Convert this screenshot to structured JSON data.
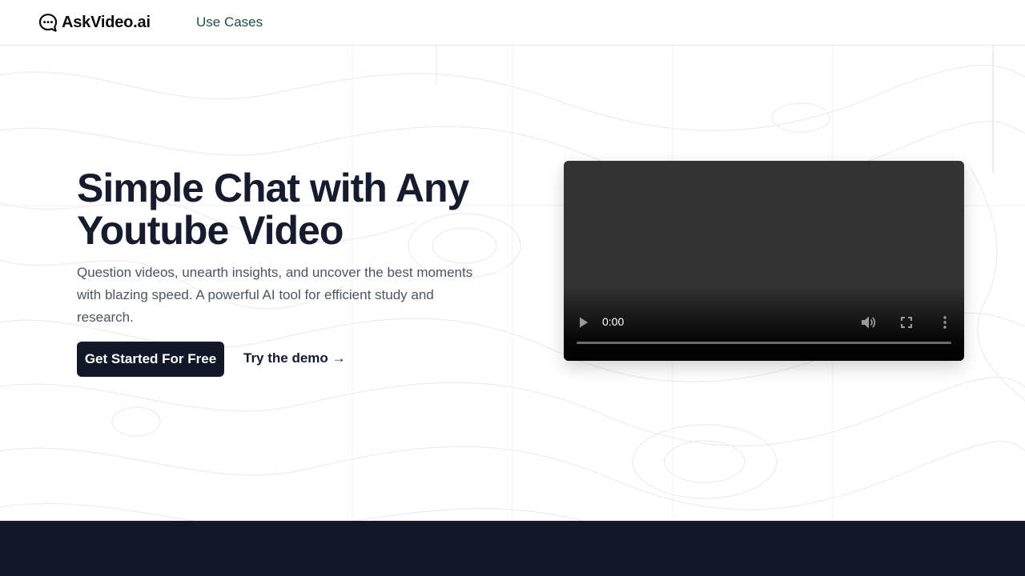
{
  "header": {
    "brand": "AskVideo.ai",
    "nav": [
      {
        "label": "Use Cases"
      }
    ]
  },
  "hero": {
    "headline": "Simple Chat with Any Youtube Video",
    "subheadline": "Question videos, unearth insights, and uncover the best moments with blazing speed. A powerful AI tool for efficient study and research.",
    "primary_cta": "Get Started For Free",
    "secondary_cta": "Try the demo →"
  },
  "video_player": {
    "time": "0:00",
    "progress": 0,
    "icons": [
      "play-icon",
      "volume-icon",
      "fullscreen-icon",
      "more-options-icon"
    ]
  },
  "colors": {
    "brand_dark": "#121828",
    "headline": "#161b2e",
    "nav_link": "#1f4e4a",
    "body_text": "#4b5563",
    "video_bg": "#333333"
  }
}
